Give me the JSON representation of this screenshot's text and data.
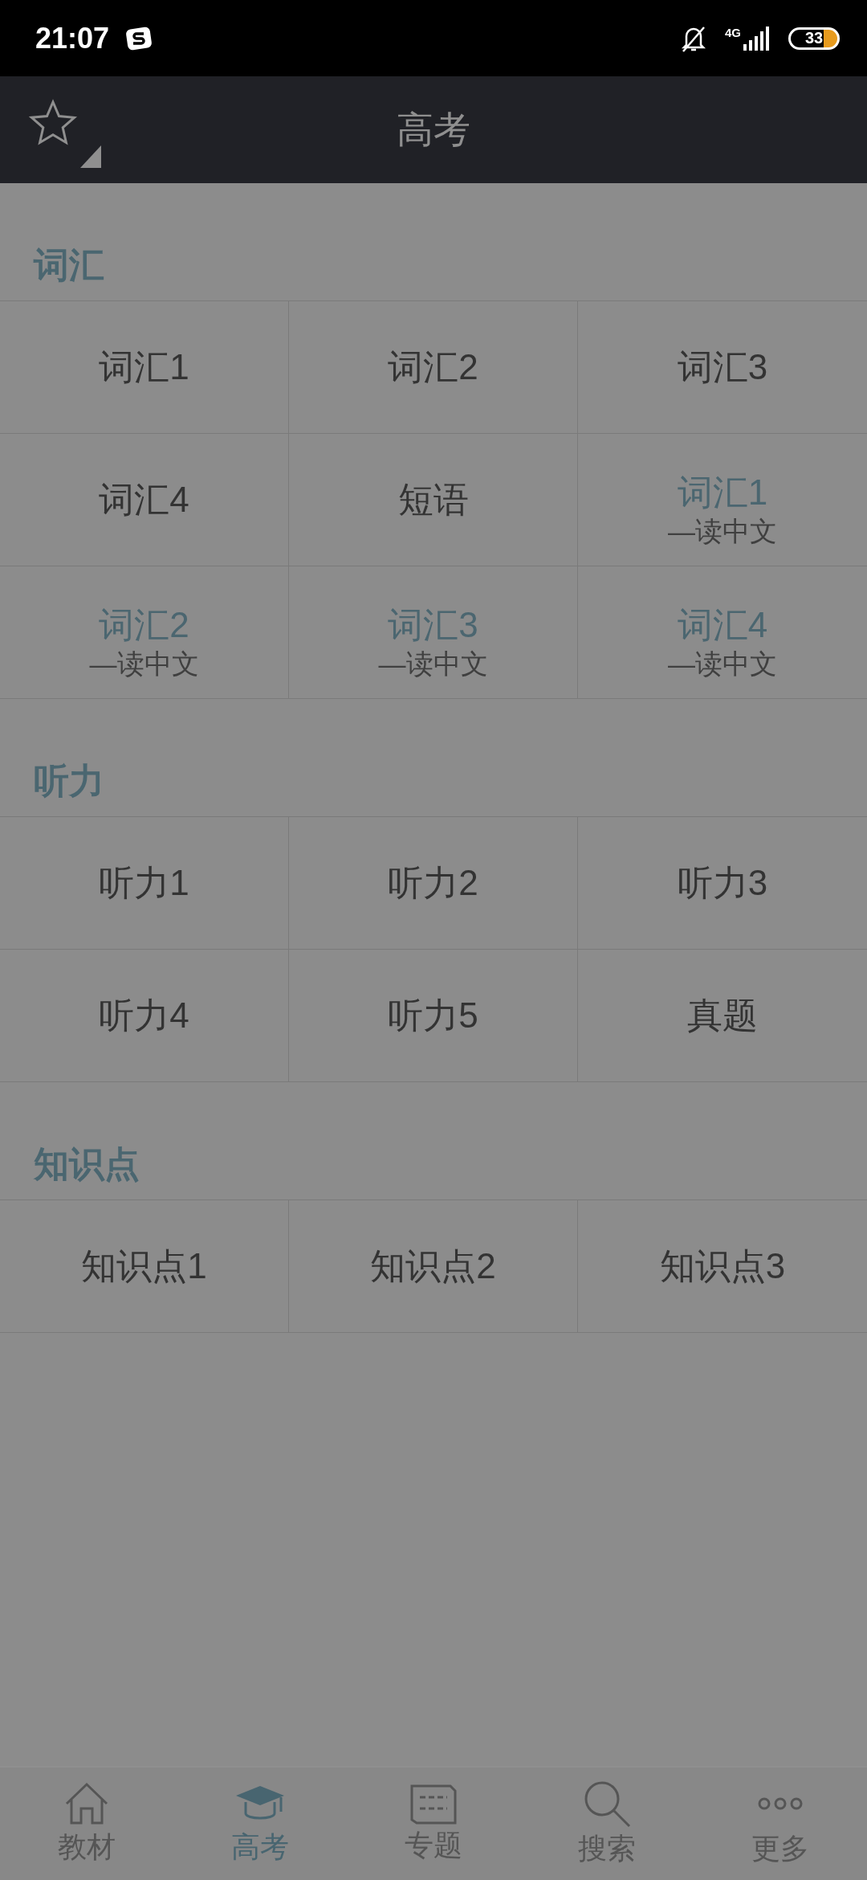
{
  "status_bar": {
    "time": "21:07",
    "network": "4G",
    "battery": "33"
  },
  "header": {
    "title": "高考"
  },
  "sections": [
    {
      "title": "词汇",
      "cells": [
        {
          "kind": "plain",
          "label": "词汇1"
        },
        {
          "kind": "plain",
          "label": "词汇2"
        },
        {
          "kind": "plain",
          "label": "词汇3"
        },
        {
          "kind": "plain",
          "label": "词汇4"
        },
        {
          "kind": "plain",
          "label": "短语"
        },
        {
          "kind": "reading",
          "label": "词汇1",
          "subtitle": "—读中文"
        },
        {
          "kind": "reading",
          "label": "词汇2",
          "subtitle": "—读中文"
        },
        {
          "kind": "reading",
          "label": "词汇3",
          "subtitle": "—读中文"
        },
        {
          "kind": "reading",
          "label": "词汇4",
          "subtitle": "—读中文"
        }
      ]
    },
    {
      "title": "听力",
      "cells": [
        {
          "kind": "plain",
          "label": "听力1"
        },
        {
          "kind": "plain",
          "label": "听力2"
        },
        {
          "kind": "plain",
          "label": "听力3"
        },
        {
          "kind": "plain",
          "label": "听力4"
        },
        {
          "kind": "plain",
          "label": "听力5"
        },
        {
          "kind": "plain",
          "label": "真题"
        }
      ]
    },
    {
      "title": "知识点",
      "cells": [
        {
          "kind": "plain",
          "label": "知识点1"
        },
        {
          "kind": "plain",
          "label": "知识点2"
        },
        {
          "kind": "plain",
          "label": "知识点3"
        }
      ]
    }
  ],
  "bottom_nav": [
    {
      "label": "教材",
      "selected": false
    },
    {
      "label": "高考",
      "selected": true
    },
    {
      "label": "专题",
      "selected": false
    },
    {
      "label": "搜索",
      "selected": false
    },
    {
      "label": "更多",
      "selected": false
    }
  ]
}
